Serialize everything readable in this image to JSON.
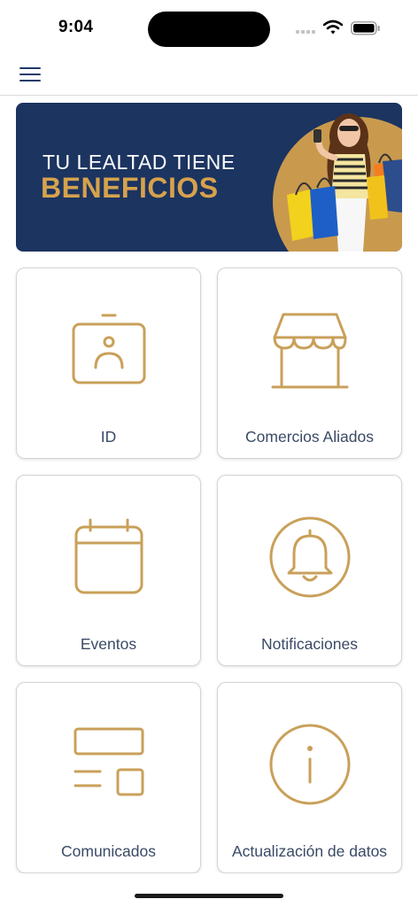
{
  "status_bar": {
    "time": "9:04"
  },
  "banner": {
    "line1": "TU LEALTAD TIENE",
    "line2": "BENEFICIOS"
  },
  "colors": {
    "navy": "#1c3460",
    "gold": "#c9a05a",
    "label": "#3a4a66"
  },
  "tiles": [
    {
      "label": "ID",
      "icon": "id-badge-icon"
    },
    {
      "label": "Comercios Aliados",
      "icon": "store-icon"
    },
    {
      "label": "Eventos",
      "icon": "calendar-icon"
    },
    {
      "label": "Notificaciones",
      "icon": "bell-icon"
    },
    {
      "label": "Comunicados",
      "icon": "layout-icon"
    },
    {
      "label": "Actualización de datos",
      "icon": "info-icon"
    }
  ]
}
